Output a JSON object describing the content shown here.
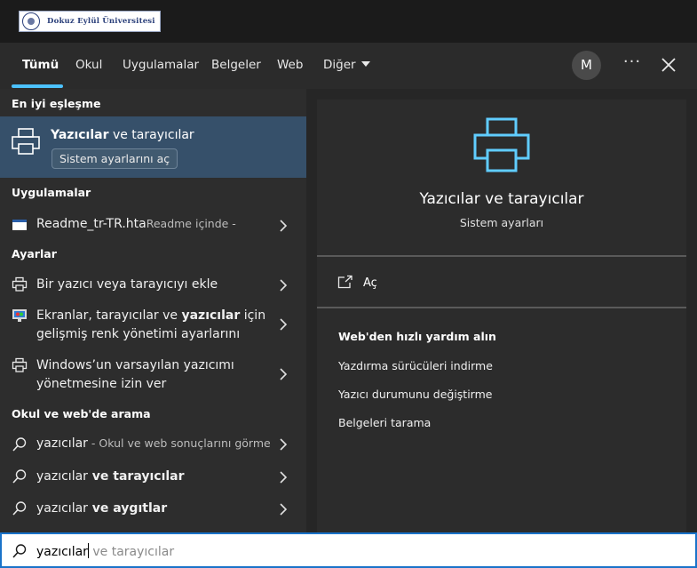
{
  "logo": {
    "text": "Dokuz Eylül Üniversitesi"
  },
  "tabs": {
    "all": "Tümü",
    "school": "Okul",
    "apps": "Uygulamalar",
    "documents": "Belgeler",
    "web": "Web",
    "more": "Diğer"
  },
  "account": {
    "initial": "M"
  },
  "best_match": {
    "heading": "En iyi eşleşme",
    "title_bold": "Yazıcılar",
    "title_rest": " ve tarayıcılar",
    "button": "Sistem ayarlarını aç"
  },
  "apps_section": {
    "heading": "Uygulamalar",
    "item_name": "Readme_tr-TR.hta",
    "item_location": "Readme içinde -"
  },
  "settings_section": {
    "heading": "Ayarlar",
    "item1": "Bir yazıcı veya tarayıcıyı ekle",
    "item2_line1_a": "Ekranlar, tarayıcılar ve ",
    "item2_line1_bold": "yazıcılar",
    "item2_line1_b": " için",
    "item2_line2": "gelişmiş renk yönetimi ayarlarını",
    "item3_line1": "Windows’un varsayılan yazıcımı",
    "item3_line2": "yönetmesine izin ver"
  },
  "web_section": {
    "heading": "Okul ve web'de arama",
    "r1_query": "yazıcılar",
    "r1_hint": " - Okul ve web sonuçlarını görme",
    "r2_query": "yazıcılar",
    "r2_bold": " ve tarayıcılar",
    "r3_query": "yazıcılar",
    "r3_bold": " ve aygıtlar"
  },
  "preview": {
    "title": "Yazıcılar ve tarayıcılar",
    "subtitle": "Sistem ayarları",
    "open_label": "Aç",
    "web_help_heading": "Web'den hızlı yardım alın",
    "links": [
      "Yazdırma sürücüleri indirme",
      "Yazıcı durumunu değiştirme",
      "Belgeleri tarama"
    ]
  },
  "search": {
    "typed": "yazıcılar",
    "suggestion": " ve tarayıcılar"
  },
  "colors": {
    "accent": "#4cc2ff",
    "selection": "#36506a",
    "search_border": "#1a73c9"
  }
}
